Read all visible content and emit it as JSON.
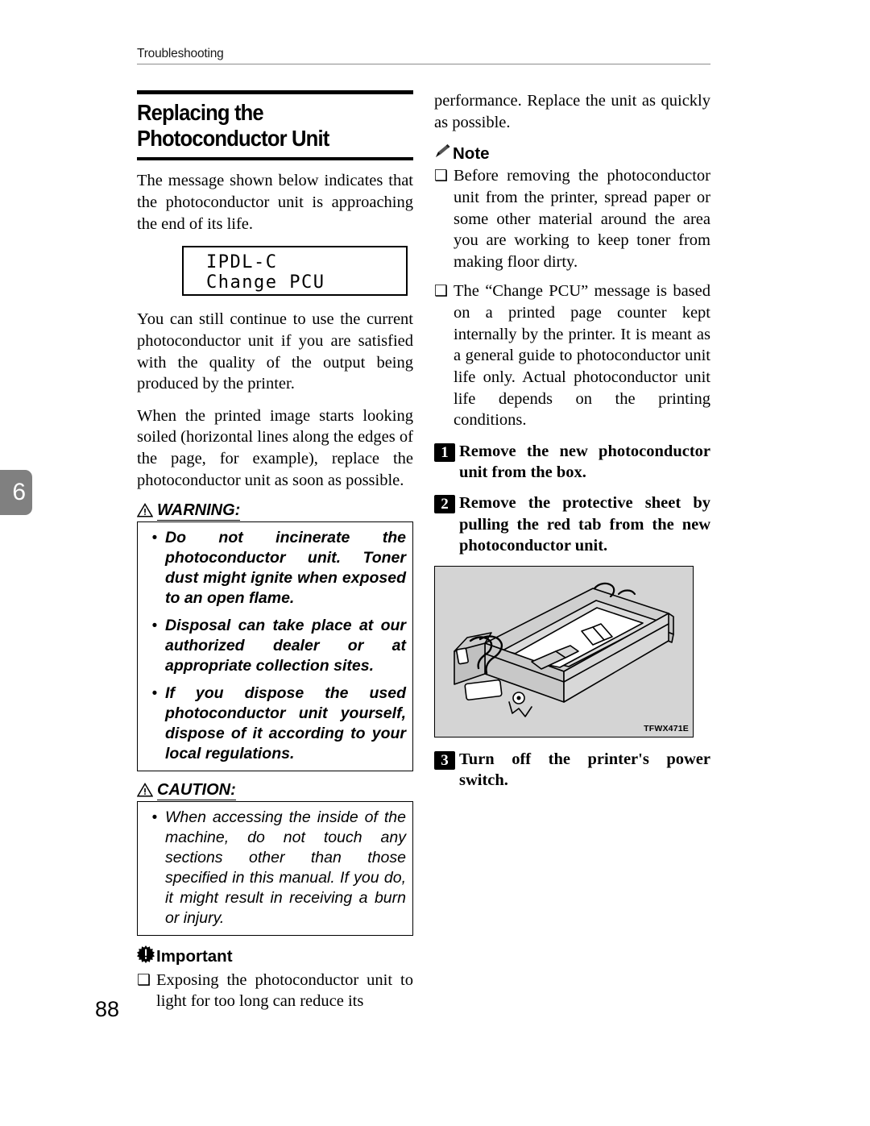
{
  "page": {
    "running_header": "Troubleshooting",
    "chapter_tab": "6",
    "page_number": "88"
  },
  "section": {
    "title": "Replacing the Photoconductor Unit"
  },
  "left_column": {
    "intro_paragraph": "The message shown below indicates that the photoconductor unit is approaching the end of its life.",
    "lcd": {
      "line1": "IPDL-C",
      "line2": "Change PCU"
    },
    "paragraph_2": "You can still continue to use the current photoconductor unit if you are satisfied with the quality of the output being produced by the printer.",
    "paragraph_3": "When the printed image starts looking soiled (horizontal lines along the edges of the page, for example), replace the photoconductor unit as soon as possible.",
    "warning": {
      "label": "WARNING:",
      "icon": "warning-triangle-icon",
      "bullet": "•",
      "items": [
        "Do not incinerate the photoconductor unit. Toner dust might ignite when exposed to an open flame.",
        "Disposal can take place at our authorized dealer or at appropriate collection sites.",
        "If you dispose the used photoconductor unit yourself, dispose of it according to your local regulations."
      ]
    },
    "caution": {
      "label": "CAUTION:",
      "icon": "warning-triangle-icon",
      "bullet": "•",
      "items": [
        "When accessing the inside of the machine, do not touch any sections other than those specified in this manual. If you do, it might result in receiving a burn or injury."
      ]
    },
    "important": {
      "label": "Important",
      "icon": "important-starburst-icon",
      "bullet": "❑",
      "items": [
        "Exposing the photoconductor unit to light for too long can reduce its"
      ]
    }
  },
  "right_column": {
    "continued_paragraph": "performance. Replace the  unit as quickly as possible.",
    "note": {
      "label": "Note",
      "icon": "note-pencil-icon",
      "bullet": "❑",
      "items": [
        "Before removing the photoconductor unit from the printer, spread paper or some other material around the area you are working to keep toner from making floor dirty.",
        "The “Change PCU” message is based on a printed page counter kept internally by the printer. It is meant as a general guide to photoconductor unit life only. Actual photoconductor unit life depends on the printing conditions."
      ]
    },
    "steps": [
      {
        "number": "1",
        "text": "Remove the new photoconductor unit from the box."
      },
      {
        "number": "2",
        "text": "Remove the protective sheet by pulling the red tab from the new photoconductor unit."
      },
      {
        "number": "3",
        "text": "Turn off the printer's power switch."
      }
    ],
    "figure": {
      "code": "TFWX471E",
      "alt": "photoconductor-unit-illustration"
    }
  },
  "colors": {
    "chapter_tab_gray": "#808080",
    "figure_bg_gray": "#d4d4d4",
    "rule_gray": "#8c8c8c",
    "text_black": "#000000"
  }
}
